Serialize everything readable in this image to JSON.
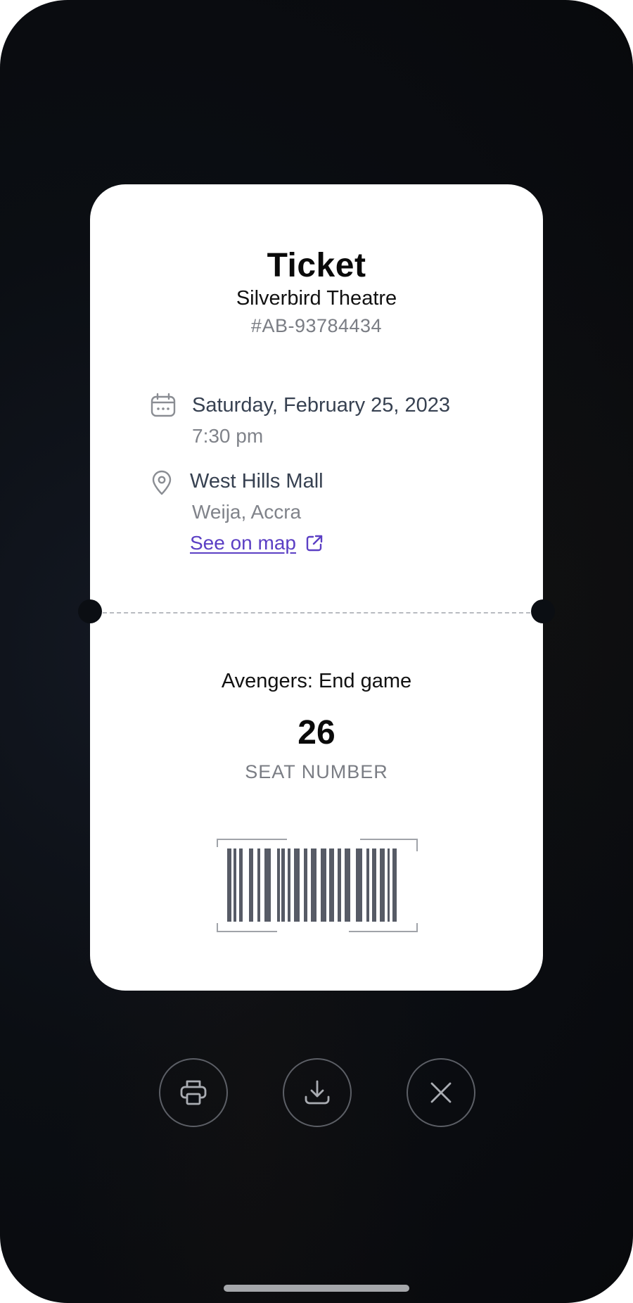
{
  "ticket": {
    "title": "Ticket",
    "venue": "Silverbird Theatre",
    "id": "#AB-93784434",
    "date": "Saturday, February 25, 2023",
    "time": "7:30 pm",
    "location": "West Hills Mall",
    "area": "Weija, Accra",
    "map_link_label": "See on map",
    "movie": "Avengers: End game",
    "seat_number": "26",
    "seat_label": "SEAT NUMBER"
  },
  "icons": {
    "date": "calendar-icon",
    "location": "map-pin-icon",
    "map_link": "external-link-icon",
    "print": "printer-icon",
    "download": "download-icon",
    "close": "close-icon"
  },
  "colors": {
    "background": "#0b0e13",
    "card": "#ffffff",
    "link": "#5b3fc4",
    "barcode": "#575b66",
    "muted_text": "#7a7d84"
  }
}
